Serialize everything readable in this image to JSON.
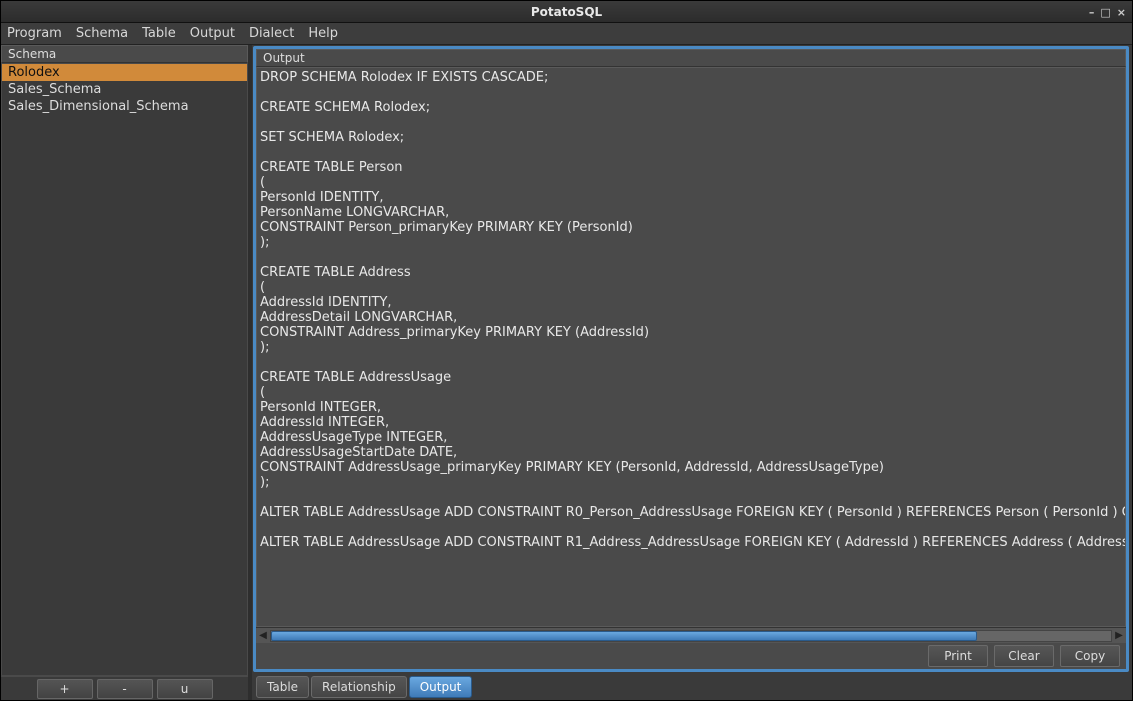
{
  "window": {
    "title": "PotatoSQL"
  },
  "menubar": [
    "Program",
    "Schema",
    "Table",
    "Output",
    "Dialect",
    "Help"
  ],
  "sidebar": {
    "header": "Schema",
    "items": [
      {
        "label": "Rolodex",
        "selected": true
      },
      {
        "label": "Sales_Schema",
        "selected": false
      },
      {
        "label": "Sales_Dimensional_Schema",
        "selected": false
      }
    ],
    "buttons": {
      "add": "+",
      "remove": "-",
      "update": "u"
    }
  },
  "output": {
    "header": "Output",
    "text": "DROP SCHEMA Rolodex IF EXISTS CASCADE;\n\nCREATE SCHEMA Rolodex;\n\nSET SCHEMA Rolodex;\n\nCREATE TABLE Person\n(\nPersonId IDENTITY,\nPersonName LONGVARCHAR,\nCONSTRAINT Person_primaryKey PRIMARY KEY (PersonId)\n);\n\nCREATE TABLE Address\n(\nAddressId IDENTITY,\nAddressDetail LONGVARCHAR,\nCONSTRAINT Address_primaryKey PRIMARY KEY (AddressId)\n);\n\nCREATE TABLE AddressUsage\n(\nPersonId INTEGER,\nAddressId INTEGER,\nAddressUsageType INTEGER,\nAddressUsageStartDate DATE,\nCONSTRAINT AddressUsage_primaryKey PRIMARY KEY (PersonId, AddressId, AddressUsageType)\n);\n\nALTER TABLE AddressUsage ADD CONSTRAINT R0_Person_AddressUsage FOREIGN KEY ( PersonId ) REFERENCES Person ( PersonId ) ON DE\n\nALTER TABLE AddressUsage ADD CONSTRAINT R1_Address_AddressUsage FOREIGN KEY ( AddressId ) REFERENCES Address ( AddressId ) O",
    "buttons": {
      "print": "Print",
      "clear": "Clear",
      "copy": "Copy"
    }
  },
  "tabs": [
    {
      "label": "Table",
      "active": false
    },
    {
      "label": "Relationship",
      "active": false
    },
    {
      "label": "Output",
      "active": true
    }
  ],
  "colors": {
    "accent": "#4a8ac4",
    "selection": "#d18a3a"
  }
}
